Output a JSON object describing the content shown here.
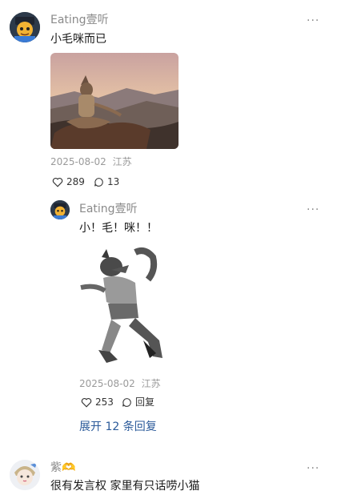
{
  "comments": [
    {
      "username": "Eating壹听",
      "text": "小毛咪而已",
      "date": "2025-08-02",
      "location": "江苏",
      "likes": "289",
      "replies": "13",
      "image": "wolf-meditating-on-rocks"
    },
    {
      "username": "Eating壹听",
      "text": "小！毛！咪！！",
      "date": "2025-08-02",
      "location": "江苏",
      "likes": "253",
      "reply_label": "回复",
      "image": "wolf-figure-dancing-sketch"
    },
    {
      "username": "紫🫶",
      "text": "很有发言权 家里有只话唠小猫"
    }
  ],
  "expand_replies": "展开 12 条回复",
  "more_glyph": "···"
}
